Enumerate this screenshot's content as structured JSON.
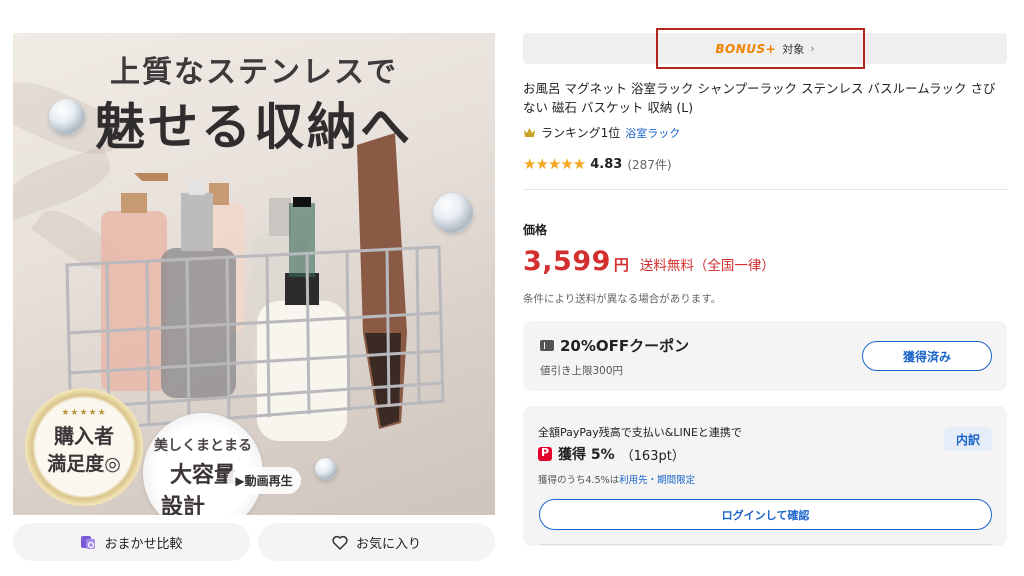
{
  "hero": {
    "copy_line1": "上質なステンレスで",
    "copy_line2": "魅せる収納へ",
    "badge1_stars": "★★★★★",
    "badge1_line1": "購入者",
    "badge1_line2": "満足度◎",
    "badge2_line1": "美しくまとまる",
    "badge2_line2": "大容量",
    "badge2_line3": "設計",
    "video_label": "▶動画再生"
  },
  "sub_buttons": {
    "compare_label": "おまかせ比較",
    "favorite_label": "お気に入り"
  },
  "bonus": {
    "logo": "BONUS+",
    "label": "対象",
    "chevron": "›",
    "highlight_color": "#b3261e"
  },
  "product": {
    "title": "お風呂 マグネット 浴室ラック シャンプーラック ステンレス バスルームラック さびない 磁石 バスケット 収納 (L)",
    "ranking_text": "ランキング1位",
    "ranking_category": "浴室ラック",
    "stars": "★★★★★",
    "rating": "4.83",
    "review_count": "(287件)"
  },
  "price": {
    "label": "価格",
    "amount": "3,599",
    "unit": "円",
    "shipping": "送料無料（全国一律）",
    "note": "条件により送料が異なる場合があります。",
    "color": "#d32f2f"
  },
  "coupon": {
    "title": "20%OFFクーポン",
    "subtitle": "値引き上限300円",
    "button_label": "獲得済み"
  },
  "paypay": {
    "title": "全額PayPay残高で支払い&LINEと連携で",
    "breakdown_label": "内訳",
    "earn_label": "獲得 5%",
    "earn_points": "（163pt）",
    "note_prefix": "獲得のうち4.5%は",
    "note_link": "利用先・期間限定",
    "login_label": "ログインして確認"
  },
  "colors": {
    "link_blue": "#1a64c9",
    "bonus_orange": "#f08300",
    "star_gold": "#f5a623"
  }
}
